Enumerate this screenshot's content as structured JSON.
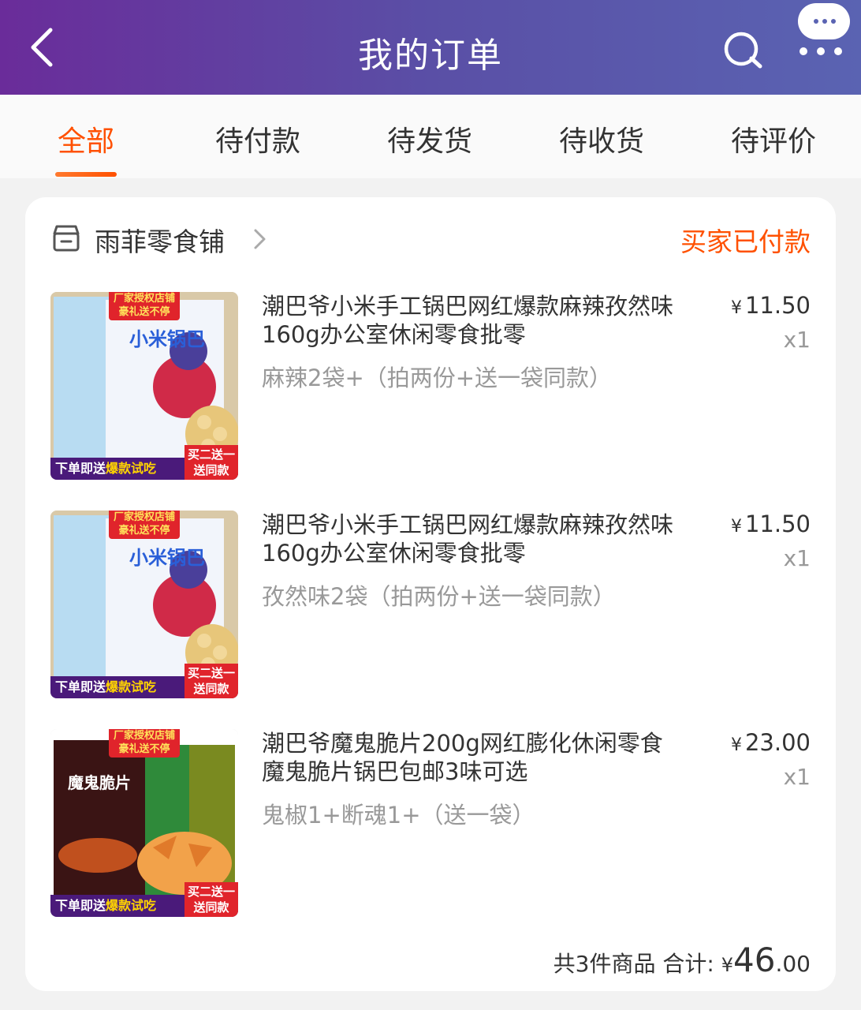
{
  "header": {
    "title": "我的订单"
  },
  "tabs": [
    {
      "label": "全部",
      "active": true
    },
    {
      "label": "待付款",
      "active": false
    },
    {
      "label": "待发货",
      "active": false
    },
    {
      "label": "待收货",
      "active": false
    },
    {
      "label": "待评价",
      "active": false
    }
  ],
  "order": {
    "store_name": "雨菲零食铺",
    "status": "买家已付款",
    "items": [
      {
        "title": "潮巴爷小米手工锅巴网红爆款麻辣孜然味160g办公室休闲零食批零",
        "sku": "麻辣2袋+（拍两份+送一袋同款）",
        "currency": "¥",
        "price": "11.50",
        "qty": "x1",
        "thumb": {
          "badge": "厂家授权店铺 豪礼送不停",
          "product_name": "小米锅巴",
          "banner_prefix": "下单即送",
          "banner_highlight": "爆款试吃",
          "corner": "买二送一 送同款"
        }
      },
      {
        "title": "潮巴爷小米手工锅巴网红爆款麻辣孜然味160g办公室休闲零食批零",
        "sku": "孜然味2袋（拍两份+送一袋同款）",
        "currency": "¥",
        "price": "11.50",
        "qty": "x1",
        "thumb": {
          "badge": "厂家授权店铺 豪礼送不停",
          "product_name": "小米锅巴",
          "banner_prefix": "下单即送",
          "banner_highlight": "爆款试吃",
          "corner": "买二送一 送同款"
        }
      },
      {
        "title": "潮巴爷魔鬼脆片200g网红膨化休闲零食魔鬼脆片锅巴包邮3味可选",
        "sku": "鬼椒1+断魂1+（送一袋）",
        "currency": "¥",
        "price": "23.00",
        "qty": "x1",
        "thumb": {
          "badge": "厂家授权店铺 豪礼送不停",
          "product_name": "魔鬼脆片",
          "banner_prefix": "下单即送",
          "banner_highlight": "爆款试吃",
          "corner": "买二送一 送同款"
        }
      }
    ],
    "summary": {
      "count_text": "共3件商品",
      "total_label": "合计:",
      "currency": "¥",
      "total_int": "46",
      "total_dec": ".00"
    }
  },
  "colors": {
    "accent": "#ff5000",
    "header_start": "#6a2c9a",
    "header_end": "#5a63b2"
  },
  "icons": [
    "back-arrow-icon",
    "search-icon",
    "more-icon",
    "store-icon",
    "chevron-right-icon"
  ]
}
